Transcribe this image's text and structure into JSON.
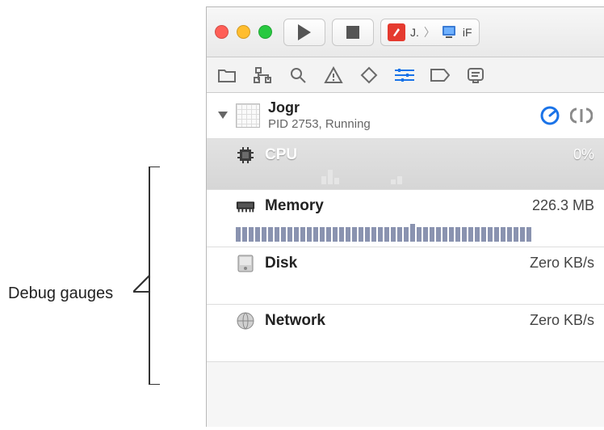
{
  "annotation": {
    "label": "Debug gauges"
  },
  "titlebar": {
    "scheme_app": "J.",
    "scheme_device": "iF"
  },
  "process": {
    "name": "Jogr",
    "status": "PID 2753, Running"
  },
  "gauges": {
    "cpu": {
      "label": "CPU",
      "value": "0%"
    },
    "memory": {
      "label": "Memory",
      "value": "226.3 MB"
    },
    "disk": {
      "label": "Disk",
      "value": "Zero KB/s"
    },
    "network": {
      "label": "Network",
      "value": "Zero KB/s"
    }
  }
}
